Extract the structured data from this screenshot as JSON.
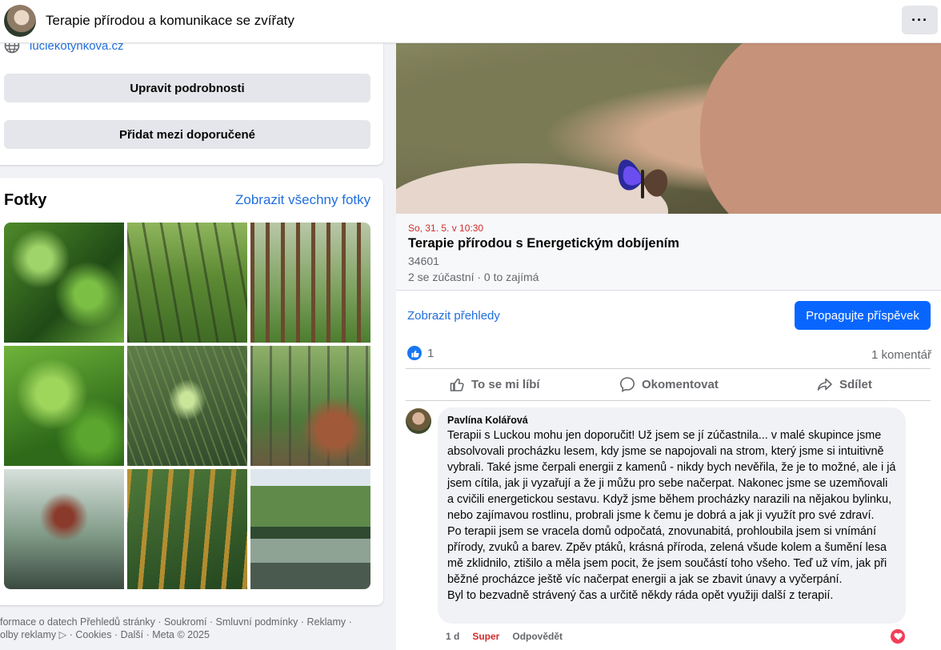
{
  "header": {
    "title": "Terapie přírodou a komunikace se zvířaty",
    "more_label": "···"
  },
  "about": {
    "website": "luciekotynkova.cz",
    "edit_button": "Upravit podrobnosti",
    "recommend_button": "Přidat mezi doporučené"
  },
  "photos": {
    "title": "Fotky",
    "see_all": "Zobrazit všechny fotky",
    "count": 9
  },
  "footer": {
    "line1": "formace o datech Přehledů stránky · Soukromí · Smluvní podmínky · Reklamy ·",
    "line2": "olby reklamy ▷ · Cookies · Další · Meta © 2025"
  },
  "event": {
    "date": "So, 31. 5. v 10:30",
    "title": "Terapie přírodou s Energetickým dobíjením",
    "postal": "34601",
    "attendance": "2 se zúčastní · 0 to zajímá",
    "insights_link": "Zobrazit přehledy",
    "promote_button": "Propagujte příspěvek"
  },
  "post": {
    "like_count": "1",
    "comment_count": "1 komentář",
    "actions": {
      "like": "To se mi líbí",
      "comment": "Okomentovat",
      "share": "Sdílet"
    }
  },
  "comment": {
    "author": "Pavlína Kolářová",
    "paragraph1": "Terapii s Luckou mohu jen doporučit! Už jsem se jí zúčastnila... v malé skupince jsme absolvovali procházku lesem, kdy jsme se napojovali na strom, který jsme si intuitivně vybrali. Také jsme čerpali energii z kamenů - nikdy bych nevěřila, že je to možné, ale i já jsem cítila, jak ji vyzařují a že ji můžu pro sebe načerpat. Nakonec jsme se uzemňovali a cvičili energetickou sestavu. Když jsme během procházky narazili na nějakou bylinku, nebo zajímavou rostlinu, probrali jsme k čemu je dobrá a jak ji využít pro své zdraví.",
    "paragraph2": "Po terapii jsem se vracela domů odpočatá, znovunabitá, prohloubila jsem si vnímání přírody, zvuků a barev. Zpěv ptáků, krásná příroda, zelená všude kolem a šumění lesa mě zklidnilo, ztišilo a měla jsem pocit, že jsem součástí toho všeho. Teď už vím, jak při běžné procházce ještě víc načerpat energii a jak se zbavit únavy a vyčerpání.",
    "paragraph3": "Byl to bezvadně strávený čas a určitě někdy ráda opět využiji další z terapií.",
    "age": "1 d",
    "reaction_label": "Super",
    "reply_label": "Odpovědět"
  },
  "colors": {
    "link": "#216fdb",
    "primary_button": "#0866ff",
    "date_red": "#d12c2c",
    "background": "#f0f2f5"
  }
}
